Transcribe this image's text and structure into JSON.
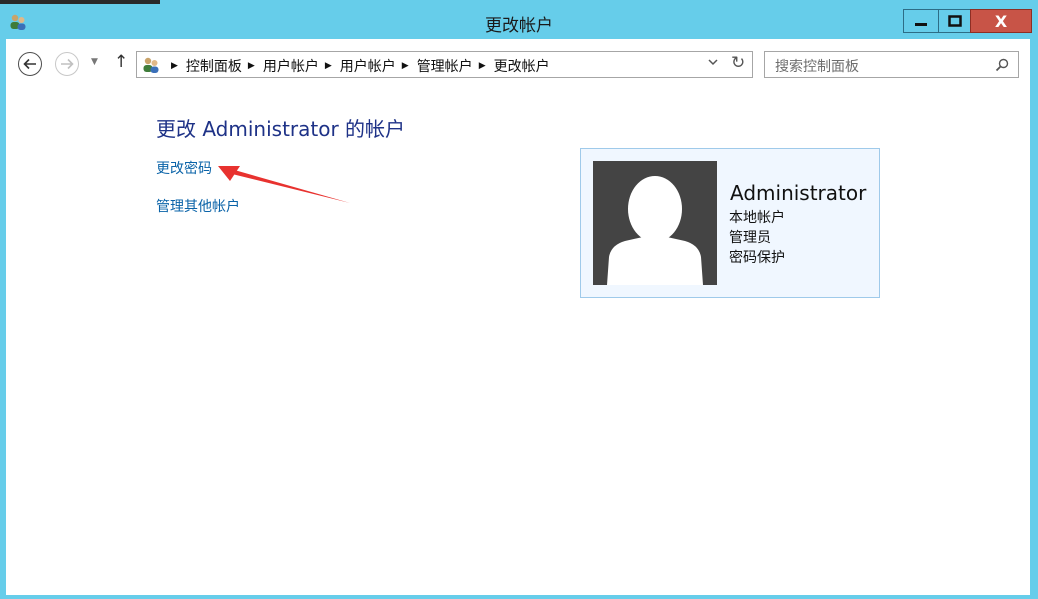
{
  "window": {
    "title": "更改帐户",
    "close_label": "X",
    "colors": {
      "frame": "#66cdea",
      "close": "#c85447",
      "link": "#0a63a8",
      "heading": "#1e3287",
      "annotation_arrow": "#e8322f"
    }
  },
  "navigation": {
    "breadcrumbs": [
      "控制面板",
      "用户帐户",
      "用户帐户",
      "管理帐户",
      "更改帐户"
    ],
    "search_placeholder": "搜索控制面板"
  },
  "main": {
    "heading": "更改 Administrator 的帐户",
    "links": {
      "change_password": "更改密码",
      "manage_other": "管理其他帐户"
    }
  },
  "account": {
    "name": "Administrator",
    "type": "本地帐户",
    "role": "管理员",
    "password_status": "密码保护"
  }
}
